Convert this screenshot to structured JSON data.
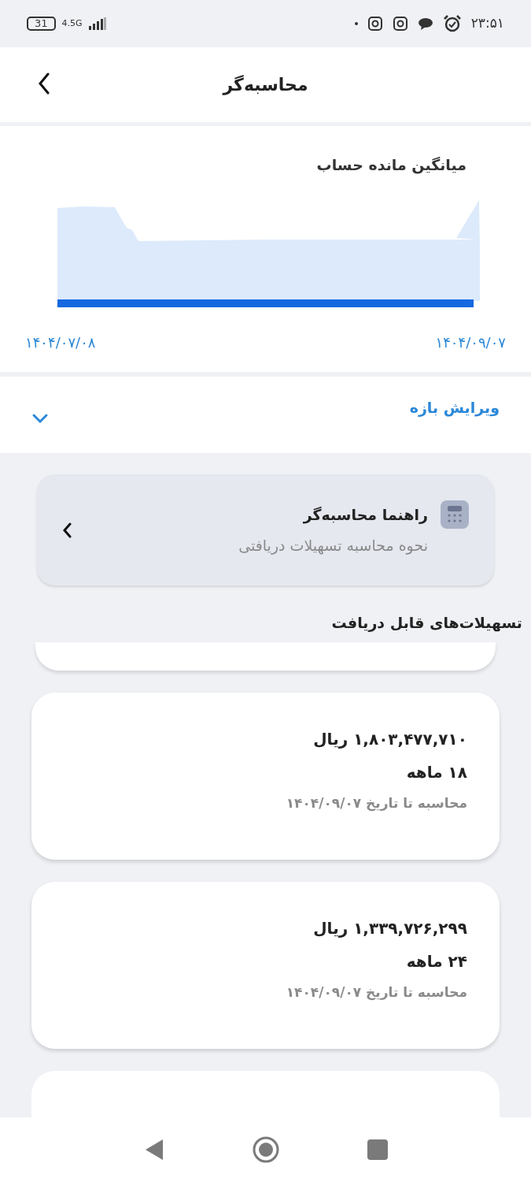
{
  "status_bar": {
    "battery": "31",
    "network": "4.5G",
    "time": "۲۳:۵۱"
  },
  "header": {
    "title": "محاسبه‌گر"
  },
  "balance_chart": {
    "title": "میانگین مانده حساب",
    "start_date": "۱۴۰۴/۰۷/۰۸",
    "end_date": "۱۴۰۴/۰۹/۰۷"
  },
  "edit_range": {
    "label": "ویرایش بازه",
    "expanded": false
  },
  "guide": {
    "title": "راهنما محاسبه‌گر",
    "subtitle": "نحوه محاسبه تسهیلات دریافتی"
  },
  "section_title": "تسهیلات‌های قابل دریافت",
  "loans": [
    {
      "amount": "۱,۸۰۳,۴۷۷,۷۱۰ ریال",
      "term": "۱۸ ماهه",
      "note": "محاسبه تا تاریخ ۱۴۰۴/۰۹/۰۷"
    },
    {
      "amount": "۱,۳۳۹,۷۲۶,۲۹۹ ریال",
      "term": "۲۴ ماهه",
      "note": "محاسبه تا تاریخ ۱۴۰۴/۰۹/۰۷"
    }
  ]
}
